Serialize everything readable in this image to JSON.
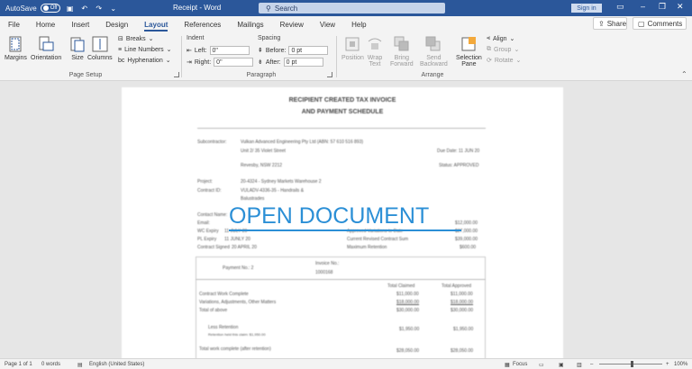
{
  "titlebar": {
    "autosave_label": "AutoSave",
    "autosave_state": "Off",
    "title": "Receipt - Word",
    "search_placeholder": "Search",
    "signin_label": "Sign in"
  },
  "tabs": [
    "File",
    "Home",
    "Insert",
    "Design",
    "Layout",
    "References",
    "Mailings",
    "Review",
    "View",
    "Help"
  ],
  "active_tab": "Layout",
  "share_label": "Share",
  "comments_label": "Comments",
  "ribbon": {
    "page_setup": {
      "margins": "Margins",
      "orientation": "Orientation",
      "size": "Size",
      "columns": "Columns",
      "breaks": "Breaks",
      "line_numbers": "Line Numbers",
      "hyphenation": "Hyphenation",
      "label": "Page Setup"
    },
    "paragraph": {
      "indent": "Indent",
      "spacing": "Spacing",
      "left_label": "Left:",
      "left_value": "0\"",
      "right_label": "Right:",
      "right_value": "0\"",
      "before_label": "Before:",
      "before_value": "0 pt",
      "after_label": "After:",
      "after_value": "0 pt",
      "label": "Paragraph"
    },
    "arrange": {
      "position": "Position",
      "wrap_text": "Wrap Text",
      "wrap_line1": "Wrap",
      "wrap_line2": "Text",
      "bring_line1": "Bring",
      "bring_line2": "Forward",
      "send_line1": "Send",
      "send_line2": "Backward",
      "selection_line1": "Selection",
      "selection_line2": "Pane",
      "align": "Align",
      "group": "Group",
      "rotate": "Rotate",
      "label": "Arrange"
    }
  },
  "document": {
    "title_line1": "RECIPIENT CREATED TAX INVOICE",
    "title_line2": "AND PAYMENT SCHEDULE",
    "subcontractor_label": "Subcontractor:",
    "subcontractor_value": "Vulkan Advanced Engineering Pty Ltd (ABN: 57 610 516 893)",
    "address1": "Unit 2/ 35 Violet Street",
    "address2": "Revesby, NSW 2212",
    "due_date": "Due Date: 11 JUN 20",
    "status": "Status: APPROVED",
    "project_label": "Project:",
    "project_value": "20-4324 - Sydney Markets Warehouse 2",
    "contract_label": "Contract ID:",
    "contract_value": "VULADV-4336-35 - Handrails &",
    "contract_value2": "Balustrades",
    "contact_label": "Contact Name:",
    "email_label": "Email:",
    "wc_expiry": "WC Expiry",
    "wc_value": "11 JULY 20",
    "pl_expiry": "PL Expiry",
    "pl_value": "11 JUNLY 20",
    "contract_signed": "Contract Signed",
    "signed_value": "20 APRIL 20",
    "approved_variations": "Approved Variations to Date",
    "approved_variations_value": "$27,000.00",
    "current_revised": "Current Revised Contract Sum",
    "current_revised_value": "$39,000.00",
    "max_retention": "Maximum Retention",
    "max_retention_value": "$600.00",
    "first_amount": "$12,000.00",
    "payment_no": "Payment No.: 2",
    "invoice_no": "Invoice No.:",
    "invoice_value": "1000168",
    "total_claimed": "Total Claimed",
    "total_approved": "Total Approved",
    "contract_work": "Contract Work Complete",
    "contract_work_claimed": "$11,000.00",
    "contract_work_approved": "$11,000.00",
    "variations": "Variations, Adjustments, Other Matters",
    "variations_claimed": "$18,000.00",
    "variations_approved": "$18,000.00",
    "total_above": "Total of above",
    "total_above_claimed": "$30,000.00",
    "total_above_approved": "$30,000.00",
    "less_retention": "Less Retention",
    "retention_note": "Retention held this claim: $1,950.00",
    "retention_claimed": "$1,950.00",
    "retention_approved": "$1,950.00",
    "total_work": "Total work complete (after retention)",
    "total_work_claimed": "$28,050.00",
    "total_work_approved": "$28,050.00"
  },
  "overlay_text": "OPEN DOCUMENT",
  "statusbar": {
    "page": "Page 1 of 1",
    "words": "0 words",
    "language": "English (United States)",
    "focus": "Focus",
    "zoom": "100%"
  },
  "colors": {
    "brand": "#2b579a",
    "overlay": "#2b8fd6"
  }
}
